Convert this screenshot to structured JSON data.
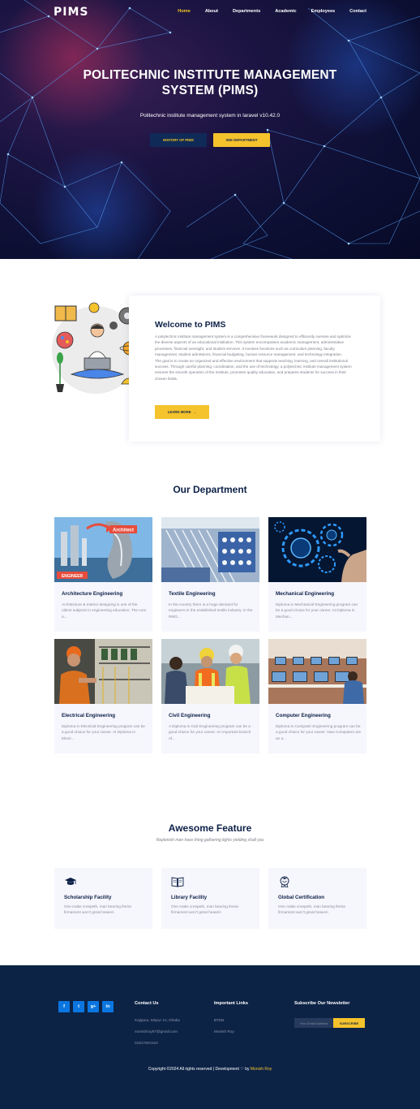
{
  "brand": {
    "logo": "PIMS"
  },
  "nav": {
    "items": [
      "Home",
      "About",
      "Departments",
      "Academic",
      "Employees",
      "Contact"
    ],
    "active_index": 0
  },
  "hero": {
    "title_line1": "POLITECHNIC INSTITUTE MANAGEMENT",
    "title_line2": "SYSTEM (PIMS)",
    "subtitle": "Politechnic institute management system in laravel v10.42.0",
    "btn_history": "HISTORY OF PIMS",
    "btn_department": "SEE DEPARTMENT"
  },
  "welcome": {
    "title": "Welcome to PIMS",
    "para1": "A polytechnic institute management system is a comprehensive framework designed to efficiently oversee and optimize the diverse aspects of an educational institution. This system encompasses academic management, administrative processes, financial oversight, and student services. It involves functions such as curriculum planning, faculty management, student admissions, financial budgeting, human resource management, and technology integration.",
    "para2": "The goal is to create an organized and effective environment that supports teaching, learning, and overall institutional success. Through careful planning, coordination, and the use of technology, a polytechnic institute management system ensures the smooth operation of the institute, promotes quality education, and prepares students for success in their chosen fields.",
    "btn": "LEARN MORE",
    "btn_arrow": "→"
  },
  "departments": {
    "title": "Our Department",
    "items": [
      {
        "name": "Architecture Engineering",
        "desc": "Architecture & Interior designing is one of the oldest subjects in engineering education. The core a...",
        "img_tag1": "Architect",
        "img_tag2": "ENGINEER"
      },
      {
        "name": "Textile Engineering",
        "desc": "In the country there is a huge demand for engineers in the established textile industry. In the RMG..."
      },
      {
        "name": "Mechanical Engineering",
        "desc": "Diploma in Mechanical Engineering program can be a good choice for your career. At Diploma in Mechan..."
      },
      {
        "name": "Electrical Engineering",
        "desc": "Diploma in Electrical Engineering program can be a good choice for your career. At Diploma in Electr..."
      },
      {
        "name": "Civil Engineering",
        "desc": "A Diploma in Civil Engineering program can be a good choice for your career. An important branch of..."
      },
      {
        "name": "Computer Engineering",
        "desc": "Diploma in Computer Engineering program can be a good choice for your career. Now Computers are an a..."
      }
    ]
  },
  "features": {
    "title": "Awesome Feature",
    "subtitle": "Replenish man have thing gathering lights yielding shall you",
    "items": [
      {
        "name": "Scholarship Facility",
        "desc": "One make creepeth, man bearing theira firmament won't great heaven",
        "icon": "graduation-cap-icon"
      },
      {
        "name": "Library Facility",
        "desc": "One make creepeth, man bearing theira firmament won't great heaven",
        "icon": "book-icon"
      },
      {
        "name": "Global Certification",
        "desc": "One make creepeth, man bearing theira firmament won't great heaven",
        "icon": "certificate-icon"
      }
    ]
  },
  "footer": {
    "social": [
      "f",
      "t",
      "g+",
      "in"
    ],
    "contact_title": "Contact Us",
    "contact_address": "Kajipara, Mirpur 10, Dhaka",
    "contact_email": "monishroy87@gmail.com",
    "contact_phone": "01817603163",
    "links_title": "Important Links",
    "link1": "BTEB",
    "link2": "Monish Roy",
    "newsletter_title": "Subscribe Our Newsletter",
    "newsletter_placeholder": "Your Email Address",
    "newsletter_btn": "SUBSCRIBE",
    "copyright_prefix": "Copyright ©2024 All rights reserved | Development",
    "copyright_heart": "♡",
    "copyright_by": "by",
    "copyright_author": "Monish Roy"
  },
  "colors": {
    "accent": "#f5c32c",
    "navy": "#0c2346",
    "button_dark": "#0f2a57",
    "social_blue": "#0b76e0"
  }
}
